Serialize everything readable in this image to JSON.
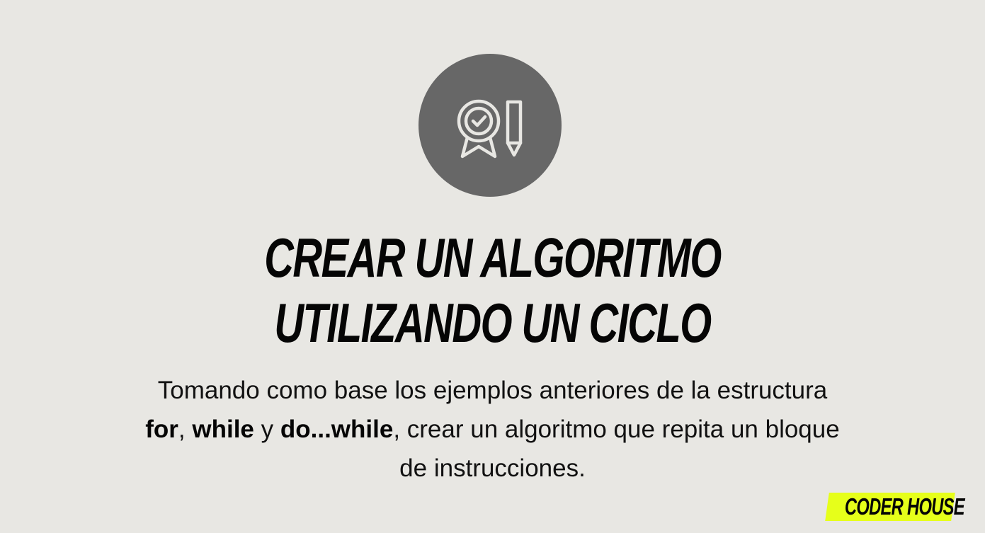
{
  "slide": {
    "icon": "award-ribbon-pencil-icon",
    "title_lines": [
      "CREAR UN ALGORITMO",
      "UTILIZANDO UN CICLO"
    ],
    "body": {
      "line1": "Tomando como base los ejemplos anteriores de la estructura",
      "kw_for": "for",
      "sep1": ", ",
      "kw_while": "while",
      "sep2": " y ",
      "kw_dowhile": "do...while",
      "rest2": ", crear un algoritmo que repita un bloque",
      "line3": "de instrucciones."
    },
    "brand": "CODER HOUSE"
  },
  "colors": {
    "background": "#e8e7e3",
    "circle": "#676767",
    "icon_stroke": "#e8e7e3",
    "title": "#050505",
    "brand_bg": "#e6ff1a"
  }
}
